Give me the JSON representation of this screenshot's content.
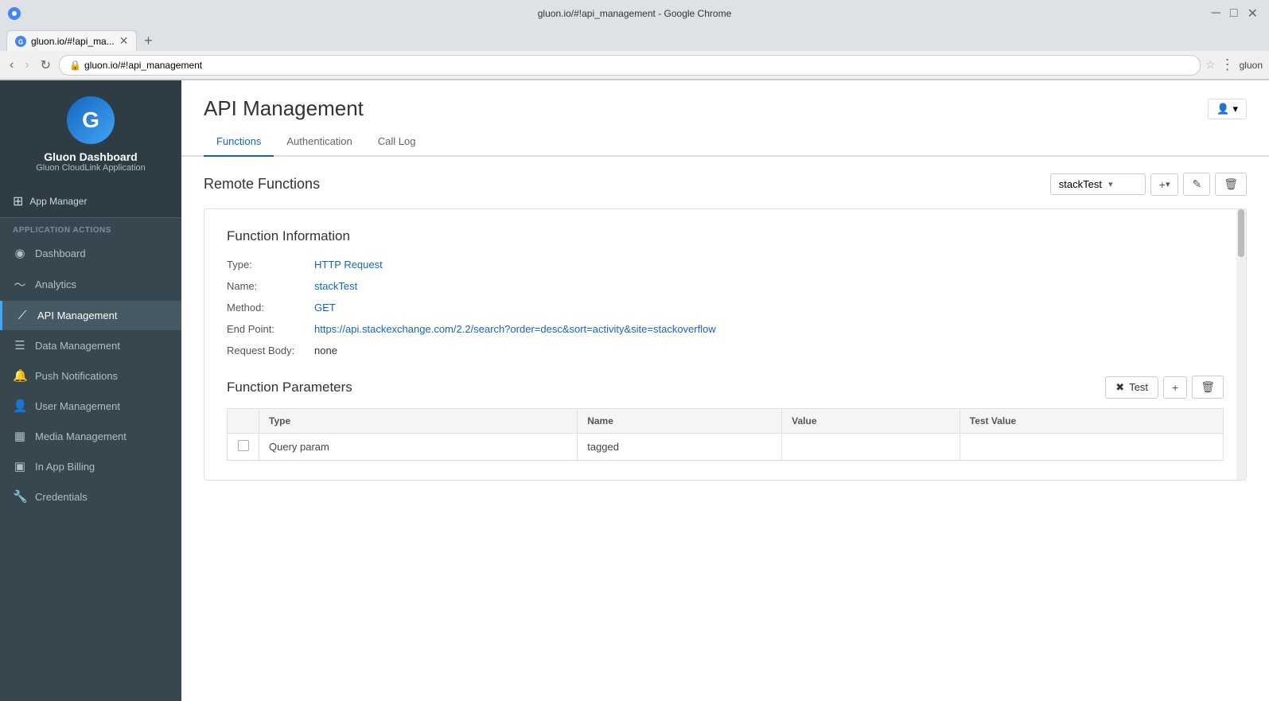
{
  "browser": {
    "title": "gluon.io/#!api_management - Google Chrome",
    "tab_label": "gluon.io/#!api_ma...",
    "address": "gluon.io/#!api_management",
    "user_profile": "gluon"
  },
  "sidebar": {
    "logo_letter": "G",
    "app_name": "Gluon Dashboard",
    "app_sub": "Gluon CloudLink Application",
    "app_manager_label": "App Manager",
    "section_label": "APPLICATION ACTIONS",
    "items": [
      {
        "id": "dashboard",
        "label": "Dashboard",
        "icon": "◉"
      },
      {
        "id": "analytics",
        "label": "Analytics",
        "icon": "〜"
      },
      {
        "id": "api-management",
        "label": "API Management",
        "icon": "⟋",
        "active": true
      },
      {
        "id": "data-management",
        "label": "Data Management",
        "icon": "☰"
      },
      {
        "id": "push-notifications",
        "label": "Push Notifications",
        "icon": "🔔"
      },
      {
        "id": "user-management",
        "label": "User Management",
        "icon": "👤"
      },
      {
        "id": "media-management",
        "label": "Media Management",
        "icon": "▦"
      },
      {
        "id": "in-app-billing",
        "label": "In App Billing",
        "icon": "▣"
      },
      {
        "id": "credentials",
        "label": "Credentials",
        "icon": "🔧"
      }
    ]
  },
  "main": {
    "page_title": "API Management",
    "user_btn_label": "▾",
    "tabs": [
      {
        "id": "functions",
        "label": "Functions",
        "active": true
      },
      {
        "id": "authentication",
        "label": "Authentication"
      },
      {
        "id": "call-log",
        "label": "Call Log"
      }
    ],
    "remote_functions": {
      "title": "Remote Functions",
      "selected_function": "stackTest",
      "add_btn": "+",
      "edit_icon": "✎",
      "delete_icon": "🗑"
    },
    "function_info": {
      "section_title": "Function Information",
      "type_label": "Type:",
      "type_value": "HTTP Request",
      "name_label": "Name:",
      "name_value": "stackTest",
      "method_label": "Method:",
      "method_value": "GET",
      "endpoint_label": "End Point:",
      "endpoint_value": "https://api.stackexchange.com/2.2/search?order=desc&sort=activity&site=stackoverflow",
      "request_body_label": "Request Body:",
      "request_body_value": "none"
    },
    "function_params": {
      "section_title": "Function Parameters",
      "test_btn_label": "Test",
      "add_icon": "+",
      "delete_icon": "🗑",
      "table": {
        "headers": [
          "",
          "Type",
          "Name",
          "Value",
          "Test Value"
        ],
        "rows": [
          {
            "checked": false,
            "type": "Query param",
            "name": "tagged",
            "value": "",
            "test_value": ""
          }
        ]
      }
    }
  }
}
